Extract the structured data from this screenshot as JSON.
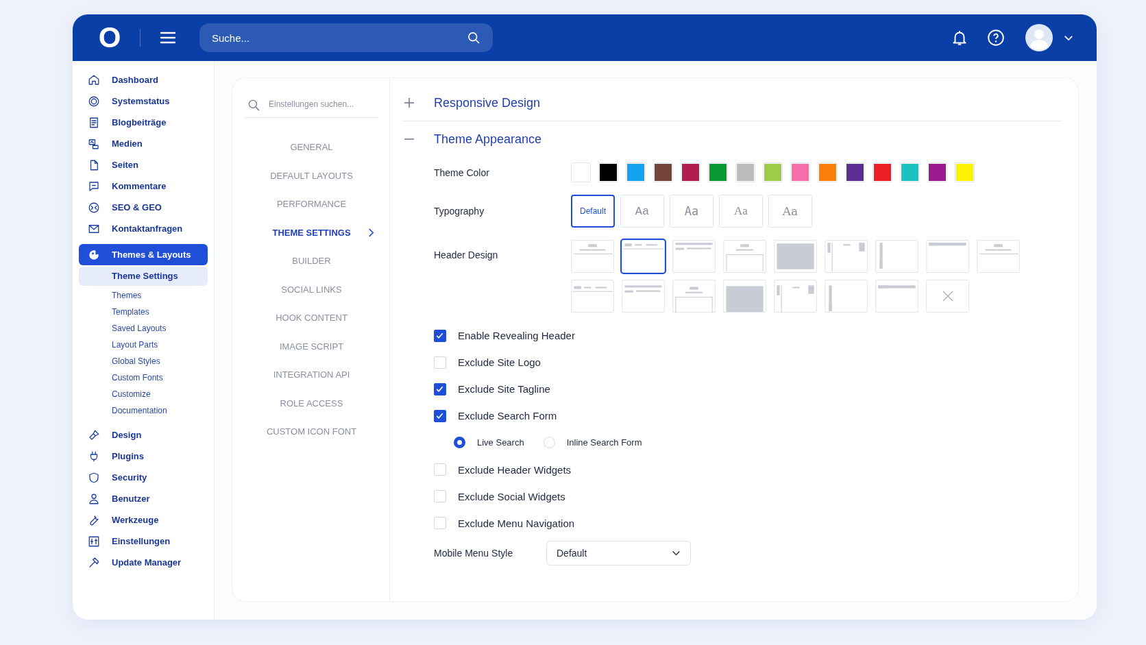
{
  "topbar": {
    "logo": "O",
    "search": {
      "placeholder": "Suche..."
    }
  },
  "sidebar": {
    "items": [
      {
        "label": "Dashboard",
        "selected": false
      },
      {
        "label": "Systemstatus",
        "selected": false
      },
      {
        "label": "Blogbeiträge",
        "selected": false
      },
      {
        "label": "Medien",
        "selected": false
      },
      {
        "label": "Seiten",
        "selected": false
      },
      {
        "label": "Kommentare",
        "selected": false
      },
      {
        "label": "SEO & GEO",
        "selected": false
      },
      {
        "label": "Kontaktanfragen",
        "selected": false
      },
      {
        "label": "Themes & Layouts",
        "selected": true,
        "children": [
          {
            "label": "Theme Settings",
            "selected": true
          },
          {
            "label": "Themes",
            "selected": false
          },
          {
            "label": "Templates",
            "selected": false
          },
          {
            "label": "Saved Layouts",
            "selected": false
          },
          {
            "label": "Layout Parts",
            "selected": false
          },
          {
            "label": "Global Styles",
            "selected": false
          },
          {
            "label": "Custom Fonts",
            "selected": false
          },
          {
            "label": "Customize",
            "selected": false
          },
          {
            "label": "Documentation",
            "selected": false
          }
        ]
      },
      {
        "label": "Design",
        "selected": false
      },
      {
        "label": "Plugins",
        "selected": false
      },
      {
        "label": "Security",
        "selected": false
      },
      {
        "label": "Benutzer",
        "selected": false
      },
      {
        "label": "Werkzeuge",
        "selected": false
      },
      {
        "label": "Einstellungen",
        "selected": false
      },
      {
        "label": "Update Manager",
        "selected": false
      }
    ]
  },
  "settings_nav": {
    "search": {
      "placeholder": "Einstellungen suchen..."
    },
    "items": [
      {
        "label": "GENERAL",
        "selected": false
      },
      {
        "label": "DEFAULT LAYOUTS",
        "selected": false
      },
      {
        "label": "PERFORMANCE",
        "selected": false
      },
      {
        "label": "THEME SETTINGS",
        "selected": true
      },
      {
        "label": "BUILDER",
        "selected": false
      },
      {
        "label": "SOCIAL LINKS",
        "selected": false
      },
      {
        "label": "HOOK CONTENT",
        "selected": false
      },
      {
        "label": "IMAGE SCRIPT",
        "selected": false
      },
      {
        "label": "INTEGRATION API",
        "selected": false
      },
      {
        "label": "ROLE ACCESS",
        "selected": false
      },
      {
        "label": "CUSTOM ICON FONT",
        "selected": false
      }
    ]
  },
  "sections": [
    {
      "title": "Responsive Design",
      "expanded": false
    },
    {
      "title": "Theme Appearance",
      "expanded": true
    }
  ],
  "theme_color": {
    "label": "Theme Color",
    "swatches": [
      {
        "color": "#ffffff"
      },
      {
        "color": "#000000"
      },
      {
        "color": "#13a4f0"
      },
      {
        "color": "#74443a"
      },
      {
        "color": "#b21c4e"
      },
      {
        "color": "#0a9a34"
      },
      {
        "color": "#bdbdbd"
      },
      {
        "color": "#9fcb4a"
      },
      {
        "color": "#f56ea8"
      },
      {
        "color": "#f98009"
      },
      {
        "color": "#5b2e91"
      },
      {
        "color": "#ec1e26"
      },
      {
        "color": "#19c3c0"
      },
      {
        "color": "#9b1b8f"
      },
      {
        "color": "#fef200"
      }
    ]
  },
  "typography": {
    "label": "Typography",
    "options": [
      {
        "label": "Default",
        "selected": true
      },
      {
        "label": "Aa",
        "selected": false
      },
      {
        "label": "Aa",
        "selected": false
      },
      {
        "label": "Aa",
        "selected": false
      },
      {
        "label": "Aa",
        "selected": false
      }
    ]
  },
  "header_design": {
    "label": "Header Design",
    "options": [
      {
        "kind": "layout",
        "selected": false
      },
      {
        "kind": "layout",
        "selected": true
      },
      {
        "kind": "layout",
        "selected": false
      },
      {
        "kind": "layout",
        "selected": false
      },
      {
        "kind": "layout",
        "selected": false
      },
      {
        "kind": "layout",
        "selected": false
      },
      {
        "kind": "layout",
        "selected": false
      },
      {
        "kind": "layout",
        "selected": false
      },
      {
        "kind": "layout",
        "selected": false
      },
      {
        "kind": "layout",
        "selected": false
      },
      {
        "kind": "layout",
        "selected": false
      },
      {
        "kind": "layout",
        "selected": false
      },
      {
        "kind": "layout",
        "selected": false
      },
      {
        "kind": "layout",
        "selected": false
      },
      {
        "kind": "layout",
        "selected": false
      },
      {
        "kind": "layout",
        "selected": false
      },
      {
        "kind": "none",
        "selected": false
      }
    ]
  },
  "options": [
    {
      "kind": "checkbox",
      "label": "Enable Revealing Header",
      "checked": true
    },
    {
      "kind": "checkbox",
      "label": "Exclude Site Logo",
      "checked": false
    },
    {
      "kind": "checkbox",
      "label": "Exclude Site Tagline",
      "checked": true
    },
    {
      "kind": "checkbox",
      "label": "Exclude Search Form",
      "checked": true
    },
    {
      "kind": "radios",
      "choices": [
        {
          "label": "Live Search",
          "selected": true
        },
        {
          "label": "Inline Search Form",
          "selected": false
        }
      ]
    },
    {
      "kind": "checkbox",
      "label": "Exclude Header Widgets",
      "checked": false
    },
    {
      "kind": "checkbox",
      "label": "Exclude Social Widgets",
      "checked": false
    },
    {
      "kind": "checkbox",
      "label": "Exclude Menu Navigation",
      "checked": false
    }
  ],
  "mobile_menu_style": {
    "label": "Mobile Menu Style",
    "value": "Default"
  }
}
